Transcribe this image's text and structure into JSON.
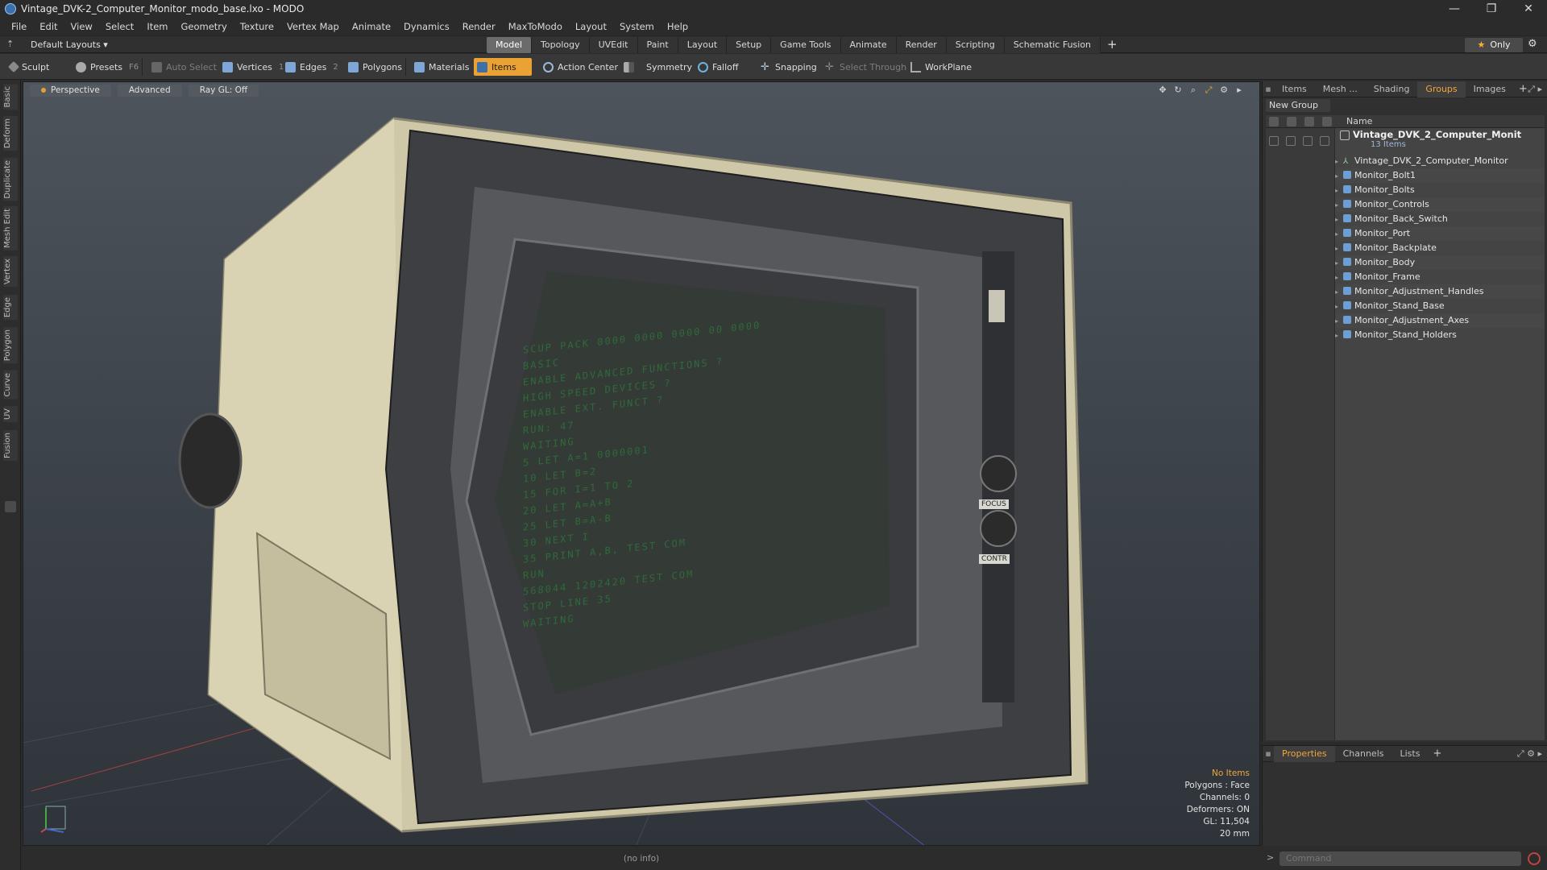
{
  "window": {
    "title": "Vintage_DVK-2_Computer_Monitor_modo_base.lxo - MODO",
    "minimize": "—",
    "maximize": "❐",
    "close": "✕"
  },
  "menu": [
    "File",
    "Edit",
    "View",
    "Select",
    "Item",
    "Geometry",
    "Texture",
    "Vertex Map",
    "Animate",
    "Dynamics",
    "Render",
    "MaxToModo",
    "Layout",
    "System",
    "Help"
  ],
  "layout_bar": {
    "layouts_label": "Default Layouts ▾",
    "tabs": [
      "Model",
      "Topology",
      "UVEdit",
      "Paint",
      "Layout",
      "Setup",
      "Game Tools",
      "Animate",
      "Render",
      "Scripting",
      "Schematic Fusion"
    ],
    "active_tab": "Model",
    "only_label": "Only"
  },
  "toolbar": {
    "sculpt": "Sculpt",
    "presets": "Presets",
    "presets_key": "F6",
    "auto_select": "Auto Select",
    "vertices": "Vertices",
    "vertices_key": "1",
    "edges": "Edges",
    "edges_key": "2",
    "polygons": "Polygons",
    "materials": "Materials",
    "items": "Items",
    "action_center": "Action Center",
    "symmetry": "Symmetry",
    "falloff": "Falloff",
    "snapping": "Snapping",
    "select_through": "Select Through",
    "workplane": "WorkPlane"
  },
  "left_tabs": [
    "Basic",
    "Deform",
    "Duplicate",
    "Mesh Edit",
    "Vertex",
    "Edge",
    "Polygon",
    "Curve",
    "UV",
    "Fusion"
  ],
  "viewport": {
    "view_mode": "Perspective",
    "shading": "Advanced",
    "raygl": "Ray GL: Off",
    "info": {
      "items": "No Items",
      "polygons": "Polygons : Face",
      "channels": "Channels: 0",
      "deformers": "Deformers: ON",
      "gl": "GL: 11,504",
      "scale": "20 mm"
    },
    "screen_lines": [
      "SCUP PACK 0000 0000 0000 00 0000",
      "BASIC",
      "ENABLE ADVANCED FUNCTIONS ?",
      "HIGH SPEED DEVICES ?",
      "ENABLE EXT. FUNCT ?",
      "RUN: 47",
      "WAITING",
      "5 LET A=1 0000001",
      "10 LET B=2",
      "15 FOR I=1 TO 2",
      "20 LET A=A+B",
      "25 LET B=A-B",
      "30 NEXT I",
      "35 PRINT A,B, TEST COM",
      "RUN",
      "568044 1202420 TEST COM",
      "STOP LINE 35",
      "WAITING"
    ],
    "knob_labels": [
      "FOCUS",
      "CONTR"
    ]
  },
  "right_panel": {
    "tabs": [
      "Items",
      "Mesh ...",
      "Shading",
      "Groups",
      "Images"
    ],
    "active_tab": "Groups",
    "new_group": "New Group",
    "column_name": "Name",
    "group_name": "Vintage_DVK_2_Computer_Monit ...",
    "group_count": "13 Items",
    "items": [
      "Vintage_DVK_2_Computer_Monitor",
      "Monitor_Bolt1",
      "Monitor_Bolts",
      "Monitor_Controls",
      "Monitor_Back_Switch",
      "Monitor_Port",
      "Monitor_Backplate",
      "Monitor_Body",
      "Monitor_Frame",
      "Monitor_Adjustment_Handles",
      "Monitor_Stand_Base",
      "Monitor_Adjustment_Axes",
      "Monitor_Stand_Holders"
    ]
  },
  "props_panel": {
    "tabs": [
      "Properties",
      "Channels",
      "Lists"
    ],
    "active_tab": "Properties"
  },
  "command": {
    "placeholder": "Command"
  },
  "status": {
    "text": "(no info)"
  },
  "colors": {
    "accent": "#e9a233",
    "mesh_icon": "#6d9fd4",
    "screen_text": "#2f6a3a"
  }
}
